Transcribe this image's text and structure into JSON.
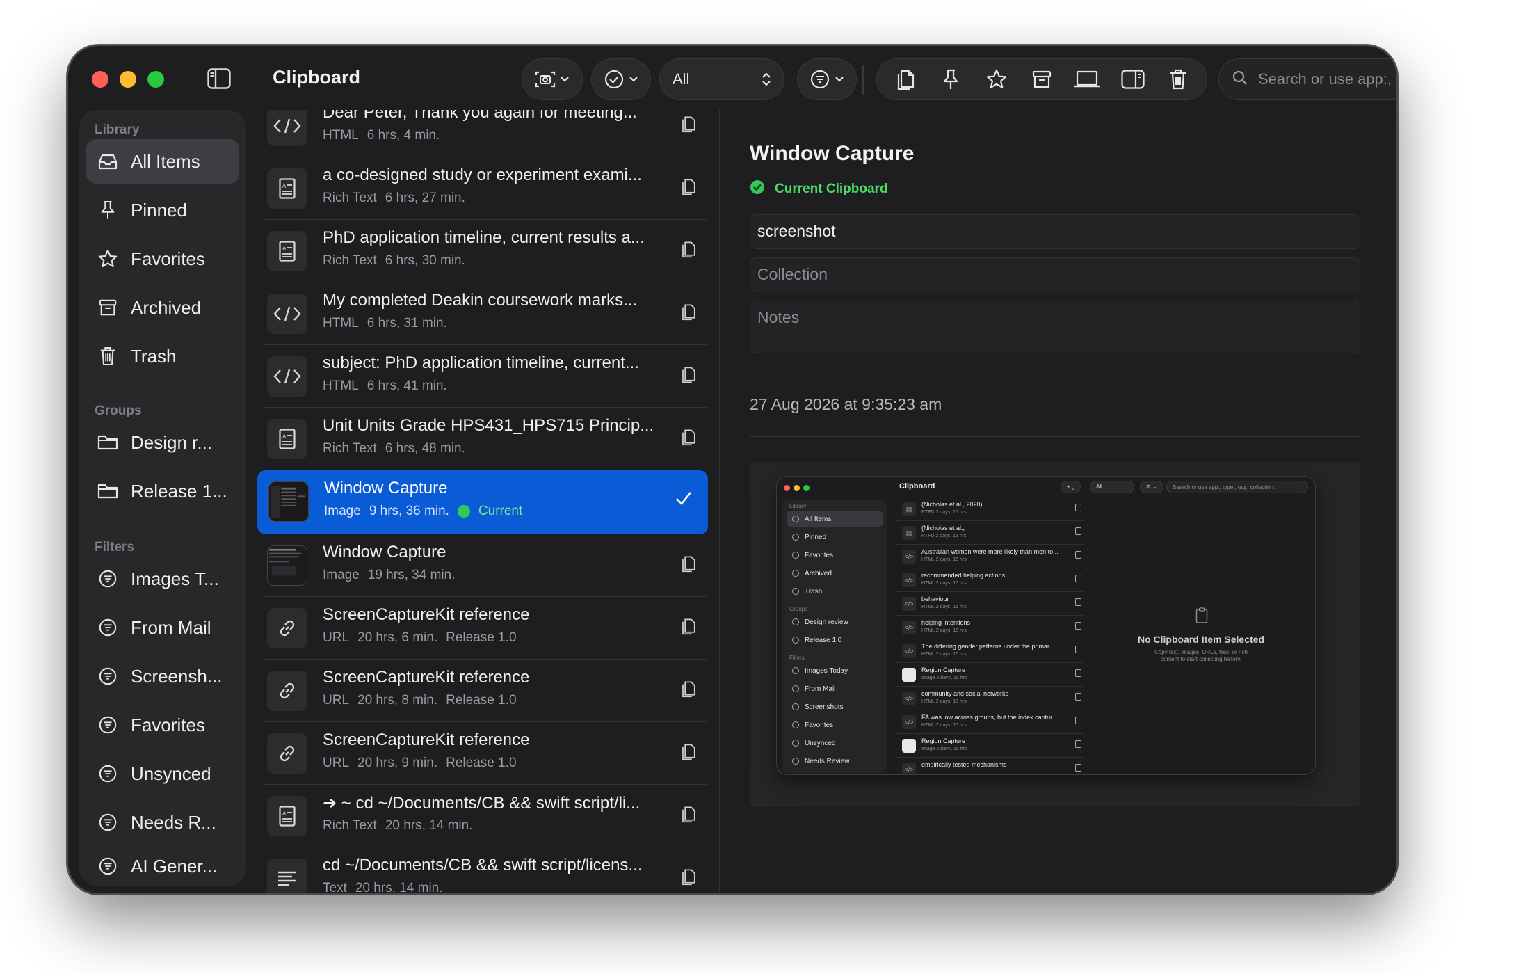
{
  "window": {
    "title": "Clipboard",
    "filter_value": "All",
    "search_placeholder": "Search or use app:, ty"
  },
  "sidebar": {
    "library_label": "Library",
    "library": [
      {
        "label": "All Items",
        "icon": "tray-icon",
        "selected": true
      },
      {
        "label": "Pinned",
        "icon": "pin-icon"
      },
      {
        "label": "Favorites",
        "icon": "star-icon"
      },
      {
        "label": "Archived",
        "icon": "archive-box-icon"
      },
      {
        "label": "Trash",
        "icon": "trash-icon"
      }
    ],
    "groups_label": "Groups",
    "groups": [
      {
        "label": "Design r...",
        "icon": "folder-icon"
      },
      {
        "label": "Release 1...",
        "icon": "folder-icon"
      }
    ],
    "filters_label": "Filters",
    "filters": [
      {
        "label": "Images T...",
        "icon": "filter-circle-icon"
      },
      {
        "label": "From Mail",
        "icon": "filter-circle-icon"
      },
      {
        "label": "Screensh...",
        "icon": "filter-circle-icon"
      },
      {
        "label": "Favorites",
        "icon": "filter-circle-icon"
      },
      {
        "label": "Unsynced",
        "icon": "filter-circle-icon"
      },
      {
        "label": "Needs R...",
        "icon": "filter-circle-icon"
      },
      {
        "label": "AI Gener...",
        "icon": "filter-circle-icon"
      }
    ]
  },
  "list": [
    {
      "title": "Dear Peter, Thank you again for meeting...",
      "type": "HTML",
      "age": "6 hrs, 4 min.",
      "icon": "code-icon"
    },
    {
      "title": "a co-designed study or experiment exami...",
      "type": "Rich Text",
      "age": "6 hrs, 27 min.",
      "icon": "rich-text-doc-icon"
    },
    {
      "title": "PhD application timeline, current results a...",
      "type": "Rich Text",
      "age": "6 hrs, 30 min.",
      "icon": "rich-text-doc-icon"
    },
    {
      "title": "My completed Deakin coursework marks...",
      "type": "HTML",
      "age": "6 hrs, 31 min.",
      "icon": "code-icon"
    },
    {
      "title": "subject: PhD application timeline, current...",
      "type": "HTML",
      "age": "6 hrs, 41 min.",
      "icon": "code-icon"
    },
    {
      "title": "Unit Units Grade HPS431_HPS715 Princip...",
      "type": "Rich Text",
      "age": "6 hrs, 48 min.",
      "icon": "rich-text-doc-icon"
    },
    {
      "title": "Window Capture",
      "type": "Image",
      "age": "9 hrs, 36 min.",
      "icon": "image-thumbnail",
      "selected": true,
      "status": "Current"
    },
    {
      "title": "Window Capture",
      "type": "Image",
      "age": "19 hrs, 34 min.",
      "icon": "image-thumbnail"
    },
    {
      "title": "ScreenCaptureKit reference",
      "type": "URL",
      "age": "20 hrs, 6 min.",
      "group": "Release 1.0",
      "icon": "link-icon"
    },
    {
      "title": "ScreenCaptureKit reference",
      "type": "URL",
      "age": "20 hrs, 8 min.",
      "group": "Release 1.0",
      "icon": "link-icon"
    },
    {
      "title": "ScreenCaptureKit reference",
      "type": "URL",
      "age": "20 hrs, 9 min.",
      "group": "Release 1.0",
      "icon": "link-icon"
    },
    {
      "title": "➜ ~ cd ~/Documents/CB && swift script/li...",
      "type": "Rich Text",
      "age": "20 hrs, 14 min.",
      "icon": "rich-text-doc-icon"
    },
    {
      "title": "cd ~/Documents/CB && swift script/licens...",
      "type": "Text",
      "age": "20 hrs, 14 min.",
      "icon": "text-lines-icon"
    }
  ],
  "detail": {
    "title": "Window Capture",
    "status": "Current Clipboard",
    "tag_value": "screenshot",
    "collection_placeholder": "Collection",
    "notes_placeholder": "Notes",
    "date": "27 Aug 2026 at 9:35:23 am"
  },
  "preview": {
    "title": "Clipboard",
    "filter": "All",
    "search": "Search or use app:, type:, tag:, collection:",
    "library_label": "Library",
    "library": [
      "All Items",
      "Pinned",
      "Favorites",
      "Archived",
      "Trash"
    ],
    "groups_label": "Groups",
    "groups": [
      "Design review",
      "Release 1.0"
    ],
    "filters_label": "Filters",
    "filters": [
      "Images Today",
      "From Mail",
      "Screenshots",
      "Favorites",
      "Unsynced",
      "Needs Review"
    ],
    "rows": [
      {
        "title": "(Nicholas et al., 2020)",
        "meta": "RTFD  2 days, 15 hrs",
        "icon": "doc"
      },
      {
        "title": "(Nicholas et al.,",
        "meta": "RTFD  2 days, 15 hrs",
        "icon": "doc"
      },
      {
        "title": "Australian women were more likely than men to...",
        "meta": "HTML  2 days, 15 hrs",
        "icon": "code"
      },
      {
        "title": "recommended helping actions",
        "meta": "HTML  2 days, 15 hrs",
        "icon": "code"
      },
      {
        "title": "behaviour",
        "meta": "HTML  2 days, 15 hrs",
        "icon": "code"
      },
      {
        "title": "helping intentions",
        "meta": "HTML  2 days, 15 hrs",
        "icon": "code"
      },
      {
        "title": "The differing gender patterns under the primar...",
        "meta": "HTML  2 days, 15 hrs",
        "icon": "code"
      },
      {
        "title": "Region Capture",
        "meta": "Image  2 days, 15 hrs",
        "icon": "image"
      },
      {
        "title": "community and social networks",
        "meta": "HTML  2 days, 15 hrs",
        "icon": "code"
      },
      {
        "title": "FA was low across groups, but the index captur...",
        "meta": "HTML  2 days, 15 hrs",
        "icon": "code"
      },
      {
        "title": "Region Capture",
        "meta": "Image  2 days, 15 hrs",
        "icon": "image"
      },
      {
        "title": "empirically tested mechanisms",
        "meta": "",
        "icon": "code"
      }
    ],
    "empty_title": "No Clipboard Item Selected",
    "empty_sub": "Copy text, images, URLs, files, or rich content to start collecting history."
  },
  "colors": {
    "accent": "#0a5bd6",
    "current_green": "#34c759",
    "window_bg": "#1e1e20",
    "sidebar_bg": "#28282b"
  }
}
